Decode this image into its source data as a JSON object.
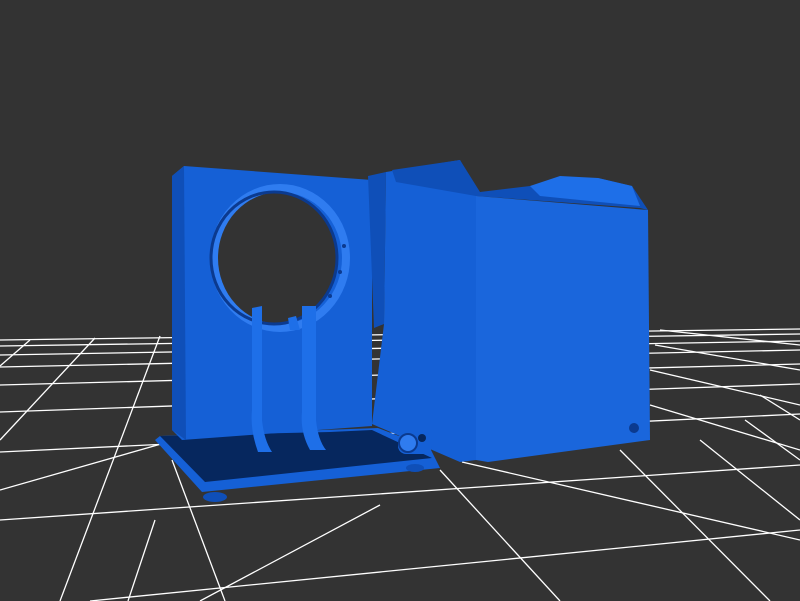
{
  "viewer": {
    "background_color": "#333333",
    "grid_color": "#ffffff",
    "model_color": "#1560d6",
    "model_shadow_color": "#0b3a8f",
    "model_highlight_color": "#2f7cf0",
    "base_plate_color": "#06275e"
  },
  "model": {
    "parts": [
      "mount-plate",
      "ring-holder",
      "support-arms",
      "base-plate",
      "enclosure-box",
      "hinge-knob"
    ]
  }
}
